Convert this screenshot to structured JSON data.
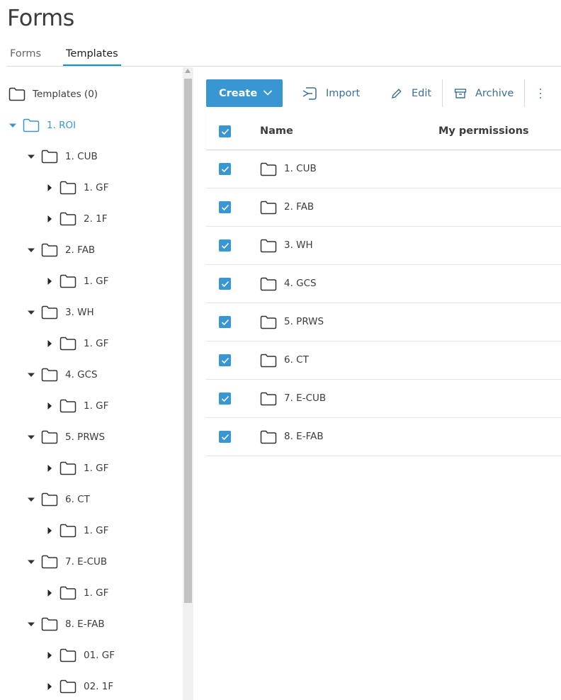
{
  "page": {
    "title": "Forms"
  },
  "tabs": [
    {
      "label": "Forms",
      "active": false
    },
    {
      "label": "Templates",
      "active": true
    }
  ],
  "tree": {
    "root_label": "Templates (0)",
    "items": [
      {
        "label": "1. ROI",
        "level": 1,
        "expanded": true,
        "selected": true
      },
      {
        "label": "1. CUB",
        "level": 2,
        "expanded": true
      },
      {
        "label": "1. GF",
        "level": 3,
        "expanded": false
      },
      {
        "label": "2. 1F",
        "level": 3,
        "expanded": false
      },
      {
        "label": "2. FAB",
        "level": 2,
        "expanded": true
      },
      {
        "label": "1. GF",
        "level": 3,
        "expanded": false
      },
      {
        "label": "3. WH",
        "level": 2,
        "expanded": true
      },
      {
        "label": "1. GF",
        "level": 3,
        "expanded": false
      },
      {
        "label": "4. GCS",
        "level": 2,
        "expanded": true
      },
      {
        "label": "1. GF",
        "level": 3,
        "expanded": false
      },
      {
        "label": "5. PRWS",
        "level": 2,
        "expanded": true
      },
      {
        "label": "1. GF",
        "level": 3,
        "expanded": false
      },
      {
        "label": "6. CT",
        "level": 2,
        "expanded": true
      },
      {
        "label": "1. GF",
        "level": 3,
        "expanded": false
      },
      {
        "label": "7. E-CUB",
        "level": 2,
        "expanded": true
      },
      {
        "label": "1. GF",
        "level": 3,
        "expanded": false
      },
      {
        "label": "8. E-FAB",
        "level": 2,
        "expanded": true
      },
      {
        "label": "01. GF",
        "level": 3,
        "expanded": false
      },
      {
        "label": "02. 1F",
        "level": 3,
        "expanded": false
      }
    ]
  },
  "toolbar": {
    "create_label": "Create",
    "import_label": "Import",
    "edit_label": "Edit",
    "archive_label": "Archive"
  },
  "table": {
    "columns": [
      "Name",
      "My permissions"
    ],
    "rows": [
      {
        "name": "1. CUB",
        "checked": true
      },
      {
        "name": "2. FAB",
        "checked": true
      },
      {
        "name": "3. WH",
        "checked": true
      },
      {
        "name": "4. GCS",
        "checked": true
      },
      {
        "name": "5. PRWS",
        "checked": true
      },
      {
        "name": "6. CT",
        "checked": true
      },
      {
        "name": "7. E-CUB",
        "checked": true
      },
      {
        "name": "8. E-FAB",
        "checked": true
      }
    ]
  },
  "colors": {
    "accent": "#3896d3",
    "selected_text": "#3a96d3",
    "tool_text": "#3a6f96"
  }
}
